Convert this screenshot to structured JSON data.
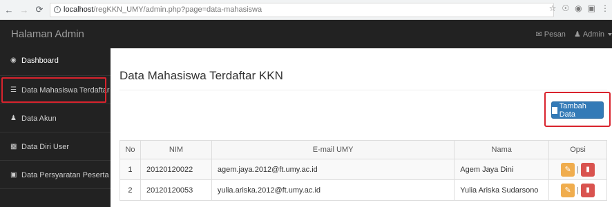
{
  "browser": {
    "url_host": "localhost",
    "url_path": "/regKKN_UMY/admin.php?page=data-mahasiswa"
  },
  "navbar": {
    "brand": "Halaman Admin",
    "messages_label": "Pesan",
    "user_label": "Admin"
  },
  "sidebar": {
    "items": [
      {
        "label": "Dashboard",
        "icon": "dashboard-icon"
      },
      {
        "label": "Data Mahasiswa Terdaftar",
        "icon": "list-icon"
      },
      {
        "label": "Data Akun",
        "icon": "users-icon"
      },
      {
        "label": "Data Diri User",
        "icon": "folder-icon"
      },
      {
        "label": "Data Persyaratan Peserta",
        "icon": "picture-icon"
      }
    ]
  },
  "main": {
    "title": "Data Mahasiswa Terdaftar KKN",
    "add_button_label": "Tambah Data",
    "table": {
      "headers": [
        "No",
        "NIM",
        "E-mail UMY",
        "Nama",
        "Opsi"
      ],
      "rows": [
        {
          "no": "1",
          "nim": "20120120022",
          "email": "agem.jaya.2012@ft.umy.ac.id",
          "nama": "Agem Jaya Dini"
        },
        {
          "no": "2",
          "nim": "20120120053",
          "email": "yulia.ariska.2012@ft.umy.ac.id",
          "nama": "Yulia Ariska Sudarsono"
        }
      ]
    }
  },
  "colors": {
    "highlight": "#d9232d",
    "primary": "#337ab7",
    "warning": "#f0ad4e",
    "danger": "#d9534f",
    "navbar": "#222222"
  }
}
